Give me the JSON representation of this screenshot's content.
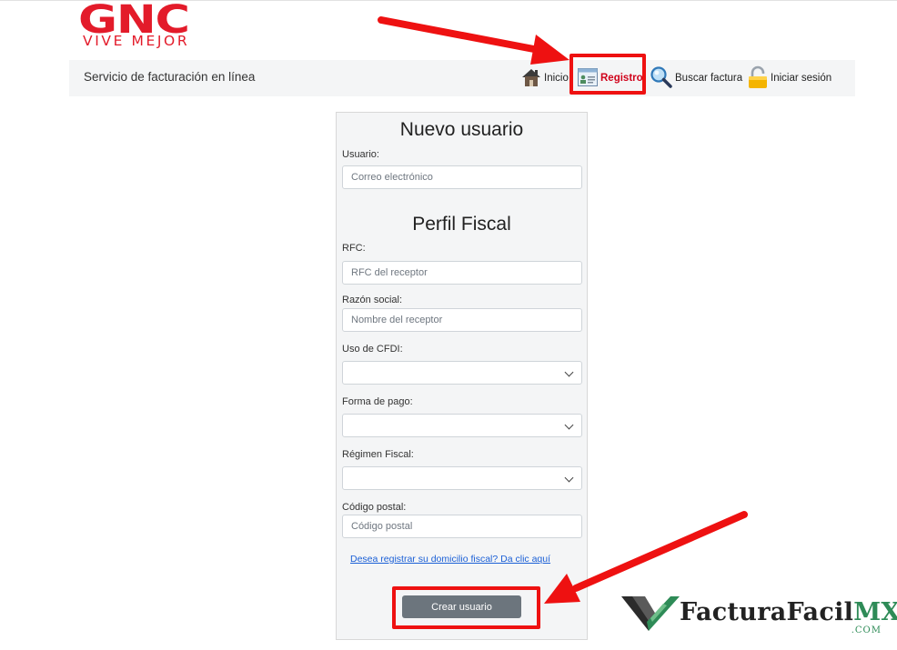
{
  "logo": {
    "main": "GNC",
    "tagline": "VIVE MEJOR"
  },
  "navbar": {
    "brand": "Servicio de facturación en línea",
    "items": [
      {
        "label": "Inicio",
        "icon": "home-icon"
      },
      {
        "label": "Registro",
        "icon": "registration-card-icon",
        "active": true
      },
      {
        "label": "Buscar factura",
        "icon": "magnifier-icon"
      },
      {
        "label": "Iniciar sesión",
        "icon": "padlock-icon"
      }
    ]
  },
  "form": {
    "title": "Nuevo usuario",
    "usuario_label": "Usuario:",
    "usuario_placeholder": "Correo electrónico",
    "fiscal_title": "Perfil Fiscal",
    "rfc_label": "RFC:",
    "rfc_placeholder": "RFC del receptor",
    "razon_label": "Razón social:",
    "razon_placeholder": "Nombre del receptor",
    "uso_label": "Uso de CFDI:",
    "uso_value": "",
    "forma_label": "Forma de pago:",
    "forma_value": "",
    "regimen_label": "Régimen Fiscal:",
    "regimen_value": "",
    "cp_label": "Código postal:",
    "cp_placeholder": "Código postal",
    "domicilio_link": "Desea registrar su domicilio fiscal? Da clic aquí",
    "submit_label": "Crear usuario"
  },
  "watermark": {
    "text": "FacturaFacil",
    "suffix": "MX",
    "domain": ".COM"
  },
  "colors": {
    "brand_red": "#e31b2a",
    "highlight_red": "#ee1111",
    "button_gray": "#6c757d",
    "link_blue": "#1a5fd6",
    "watermark_green": "#2e8b57"
  }
}
